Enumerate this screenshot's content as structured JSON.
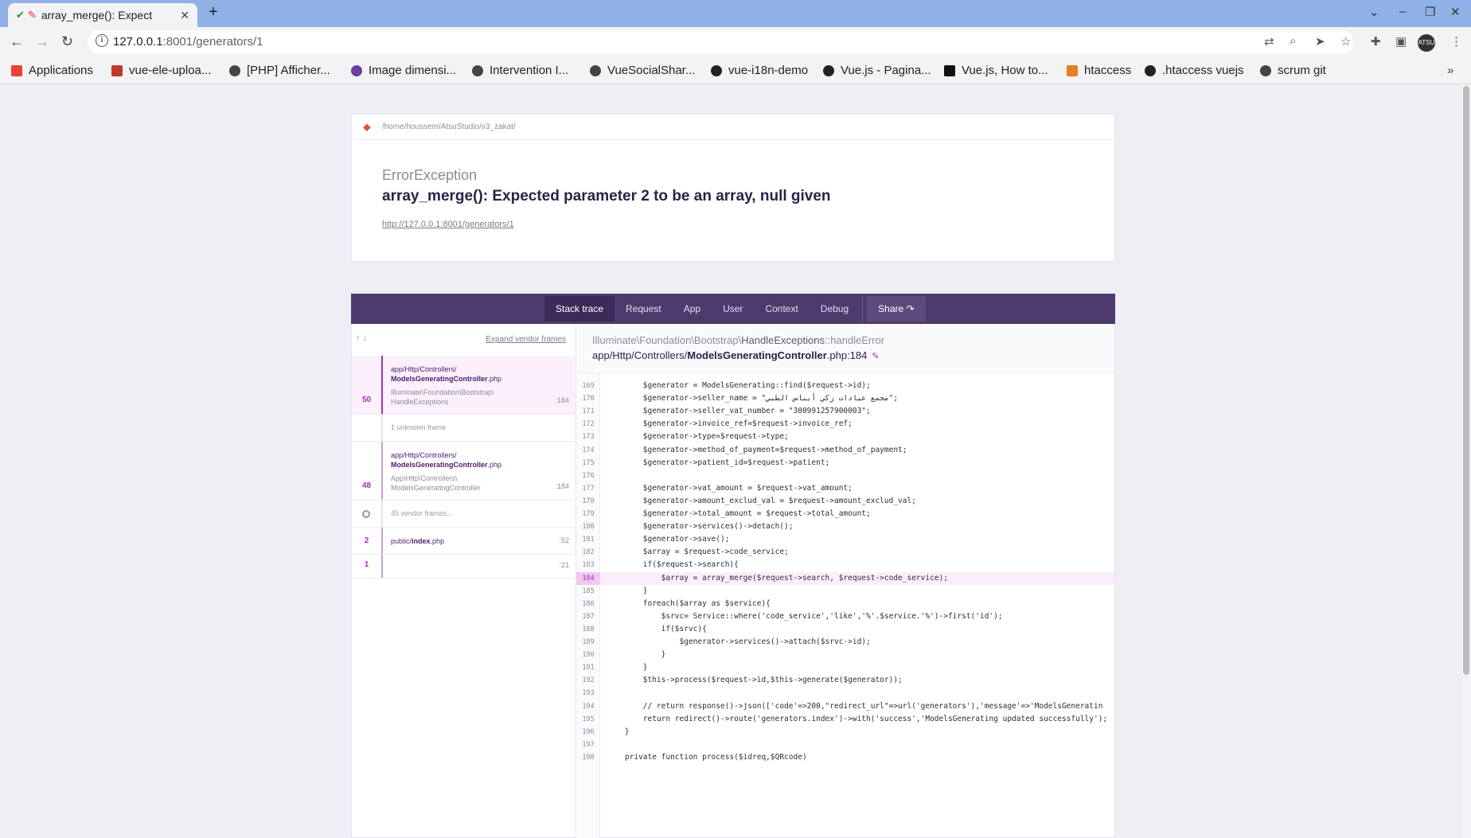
{
  "browser": {
    "tab_title": "array_merge(): Expect",
    "url_host": "127.0.0.1",
    "url_rest": ":8001/generators/1",
    "profile_initials": "ATSU",
    "bookmarks": [
      {
        "label": "Applications",
        "color": "#e94235"
      },
      {
        "label": "vue-ele-uploa...",
        "color": "#c0392b"
      },
      {
        "label": "[PHP] Afficher...",
        "color": "#444444"
      },
      {
        "label": "Image dimensi...",
        "color": "#6b3fa0"
      },
      {
        "label": "Intervention I...",
        "color": "#444444"
      },
      {
        "label": "VueSocialShar...",
        "color": "#444444"
      },
      {
        "label": "vue-i18n-demo",
        "color": "#222222"
      },
      {
        "label": "Vue.js - Pagina...",
        "color": "#222222"
      },
      {
        "label": "Vue.js, How to...",
        "color": "#111111"
      },
      {
        "label": "htaccess",
        "color": "#e67e22"
      },
      {
        "label": ".htaccess vuejs",
        "color": "#222222"
      },
      {
        "label": "scrum git",
        "color": "#444444"
      }
    ]
  },
  "error": {
    "path": "/home/houssem/AtsuStudio/v3_zakat/",
    "exception_class": "ErrorException",
    "message": "array_merge(): Expected parameter 2 to be an array, null given",
    "url": "http://127.0.0.1:8001/generators/1"
  },
  "nav": {
    "tabs": [
      "Stack trace",
      "Request",
      "App",
      "User",
      "Context",
      "Debug"
    ],
    "share": "Share"
  },
  "frames_panel": {
    "expand_label": "Expand vendor frames",
    "frames": [
      {
        "num": "50",
        "dir": "app/Http/Controllers/",
        "file": "ModelsGeneratingController",
        "ext": ".php",
        "ns": "Illuminate\\Foundation\\Bootstrap\\",
        "cls": "HandleExceptions",
        "line": ":184"
      },
      {
        "muted": "1 unknown frame"
      },
      {
        "num": "48",
        "dir": "app/Http/Controllers/",
        "file": "ModelsGeneratingController",
        "ext": ".php",
        "ns": "App\\Http\\Controllers\\",
        "cls": "ModelsGeneratingController",
        "line": ":184"
      },
      {
        "muted": "45 vendor frames..."
      },
      {
        "num": "2",
        "dir": "public/",
        "file": "index",
        "ext": ".php",
        "line": ":52"
      },
      {
        "num": "1",
        "line": ":21"
      }
    ]
  },
  "code": {
    "class_ns": "Illuminate\\Foundation\\Bootstrap\\",
    "class_name": "HandleExceptions",
    "method": "::handleError",
    "file_dir": "app/Http/Controllers/",
    "file_name": "ModelsGeneratingController",
    "file_ext": ".php:184",
    "highlight_line": 184,
    "lines": [
      {
        "n": 169,
        "t": "        $generator = ModelsGenerating::find($request->id);"
      },
      {
        "n": 170,
        "t": "        $generator->seller_name = \"مجمع عيادات زكي أيباس الطبي\";"
      },
      {
        "n": 171,
        "t": "        $generator->seller_vat_number = \"300991257900003\";"
      },
      {
        "n": 172,
        "t": "        $generator->invoice_ref=$request->invoice_ref;"
      },
      {
        "n": 173,
        "t": "        $generator->type=$request->type;"
      },
      {
        "n": 174,
        "t": "        $generator->method_of_payment=$request->method_of_payment;"
      },
      {
        "n": 175,
        "t": "        $generator->patient_id=$request->patient;"
      },
      {
        "n": 176,
        "t": ""
      },
      {
        "n": 177,
        "t": "        $generator->vat_amount = $request->vat_amount;"
      },
      {
        "n": 178,
        "t": "        $generator->amount_exclud_val = $request->amount_exclud_val;"
      },
      {
        "n": 179,
        "t": "        $generator->total_amount = $request->total_amount;"
      },
      {
        "n": 180,
        "t": "        $generator->services()->detach();"
      },
      {
        "n": 181,
        "t": "        $generator->save();"
      },
      {
        "n": 182,
        "t": "        $array = $request->code_service;"
      },
      {
        "n": 183,
        "t": "        if($request->search){"
      },
      {
        "n": 184,
        "t": "            $array = array_merge($request->search, $request->code_service);"
      },
      {
        "n": 185,
        "t": "        }"
      },
      {
        "n": 186,
        "t": "        foreach($array as $service){"
      },
      {
        "n": 187,
        "t": "            $srvc= Service::where('code_service','like','%'.$service.'%')->first('id');"
      },
      {
        "n": 188,
        "t": "            if($srvc){"
      },
      {
        "n": 189,
        "t": "                $generator->services()->attach($srvc->id);"
      },
      {
        "n": 190,
        "t": "            }"
      },
      {
        "n": 191,
        "t": "        }"
      },
      {
        "n": 192,
        "t": "        $this->process($request->id,$this->generate($generator));"
      },
      {
        "n": 193,
        "t": ""
      },
      {
        "n": 194,
        "t": "        // return response()->json(['code'=>200,\"redirect_url\"=>url('generators'),'message'=>'ModelsGeneratin"
      },
      {
        "n": 195,
        "t": "        return redirect()->route('generators.index')->with('success','ModelsGenerating updated successfully');"
      },
      {
        "n": 196,
        "t": "    }"
      },
      {
        "n": 197,
        "t": ""
      },
      {
        "n": 198,
        "t": "    private function process($idreq,$QRcode)"
      }
    ]
  }
}
